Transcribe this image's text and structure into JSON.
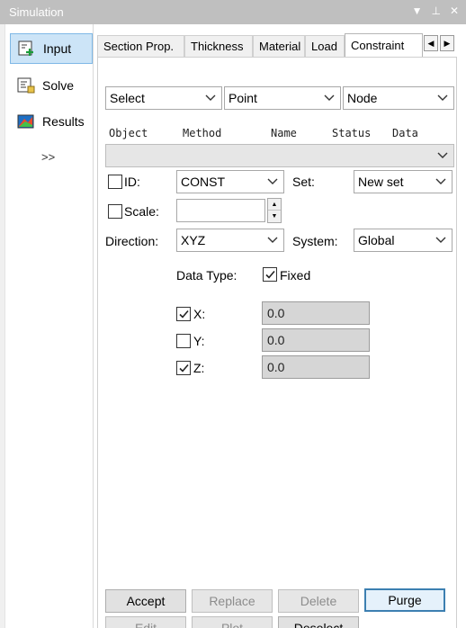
{
  "window": {
    "title": "Simulation",
    "title_icons": [
      "▼",
      "⊥",
      "✕"
    ]
  },
  "nav": {
    "items": [
      {
        "label": "Input",
        "icon": "input-icon",
        "active": true
      },
      {
        "label": "Solve",
        "icon": "solve-icon",
        "active": false
      },
      {
        "label": "Results",
        "icon": "results-icon",
        "active": false
      }
    ],
    "more": ">>"
  },
  "tabs": [
    {
      "label": "Section Prop.",
      "active": false
    },
    {
      "label": "Thickness",
      "active": false
    },
    {
      "label": "Material",
      "active": false
    },
    {
      "label": "Load",
      "active": false
    },
    {
      "label": "Constraint",
      "active": true
    }
  ],
  "selectors": {
    "select": "Select",
    "point": "Point",
    "node": "Node"
  },
  "columns": [
    "Object",
    "Method",
    "Name",
    "Status",
    "Data"
  ],
  "id_row": {
    "label": "ID:",
    "value": "CONST",
    "set_label": "Set:",
    "set_value": "New set"
  },
  "scale_row": {
    "label": "Scale:",
    "value": ""
  },
  "direction_row": {
    "label": "Direction:",
    "value": "XYZ",
    "system_label": "System:",
    "system_value": "Global"
  },
  "data_type": {
    "label": "Data Type:",
    "fixed_label": "Fixed",
    "fixed_checked": true
  },
  "components": [
    {
      "label": "X:",
      "checked": true,
      "value": "0.0"
    },
    {
      "label": "Y:",
      "checked": false,
      "value": "0.0"
    },
    {
      "label": "Z:",
      "checked": true,
      "value": "0.0"
    }
  ],
  "buttons": {
    "accept": "Accept",
    "replace": "Replace",
    "delete": "Delete",
    "purge": "Purge",
    "edit": "Edit",
    "plot": "Plot",
    "deselect": "Deselect"
  },
  "colors": {
    "titlebar": "#bfbfbf",
    "nav_active": "#cce4f7",
    "primary_border": "#3c7fb1"
  }
}
